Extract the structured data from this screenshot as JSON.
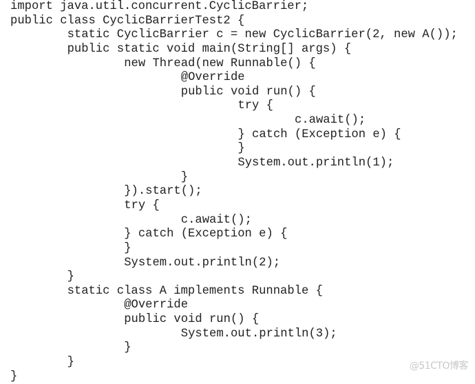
{
  "document": {
    "language": "java",
    "lines": [
      {
        "indent": 0,
        "text": "import java.util.concurrent.CyclicBarrier;"
      },
      {
        "indent": 0,
        "text": "public class CyclicBarrierTest2 {"
      },
      {
        "indent": 1,
        "text": "static CyclicBarrier c = new CyclicBarrier(2, new A());"
      },
      {
        "indent": 1,
        "text": "public static void main(String[] args) {"
      },
      {
        "indent": 2,
        "text": "new Thread(new Runnable() {"
      },
      {
        "indent": 3,
        "text": "@Override"
      },
      {
        "indent": 3,
        "text": "public void run() {"
      },
      {
        "indent": 4,
        "text": "try {"
      },
      {
        "indent": 5,
        "text": "c.await();"
      },
      {
        "indent": 4,
        "text": "} catch (Exception e) {"
      },
      {
        "indent": 4,
        "text": "}"
      },
      {
        "indent": 4,
        "text": "System.out.println(1);"
      },
      {
        "indent": 3,
        "text": "}"
      },
      {
        "indent": 2,
        "text": "}).start();"
      },
      {
        "indent": 2,
        "text": "try {"
      },
      {
        "indent": 3,
        "text": "c.await();"
      },
      {
        "indent": 2,
        "text": "} catch (Exception e) {"
      },
      {
        "indent": 2,
        "text": "}"
      },
      {
        "indent": 2,
        "text": "System.out.println(2);"
      },
      {
        "indent": 1,
        "text": "}"
      },
      {
        "indent": 1,
        "text": "static class A implements Runnable {"
      },
      {
        "indent": 2,
        "text": "@Override"
      },
      {
        "indent": 2,
        "text": "public void run() {"
      },
      {
        "indent": 3,
        "text": "System.out.println(3);"
      },
      {
        "indent": 2,
        "text": "}"
      },
      {
        "indent": 1,
        "text": "}"
      },
      {
        "indent": 0,
        "text": "}"
      }
    ]
  },
  "watermark": {
    "text": "@51CTO博客"
  }
}
